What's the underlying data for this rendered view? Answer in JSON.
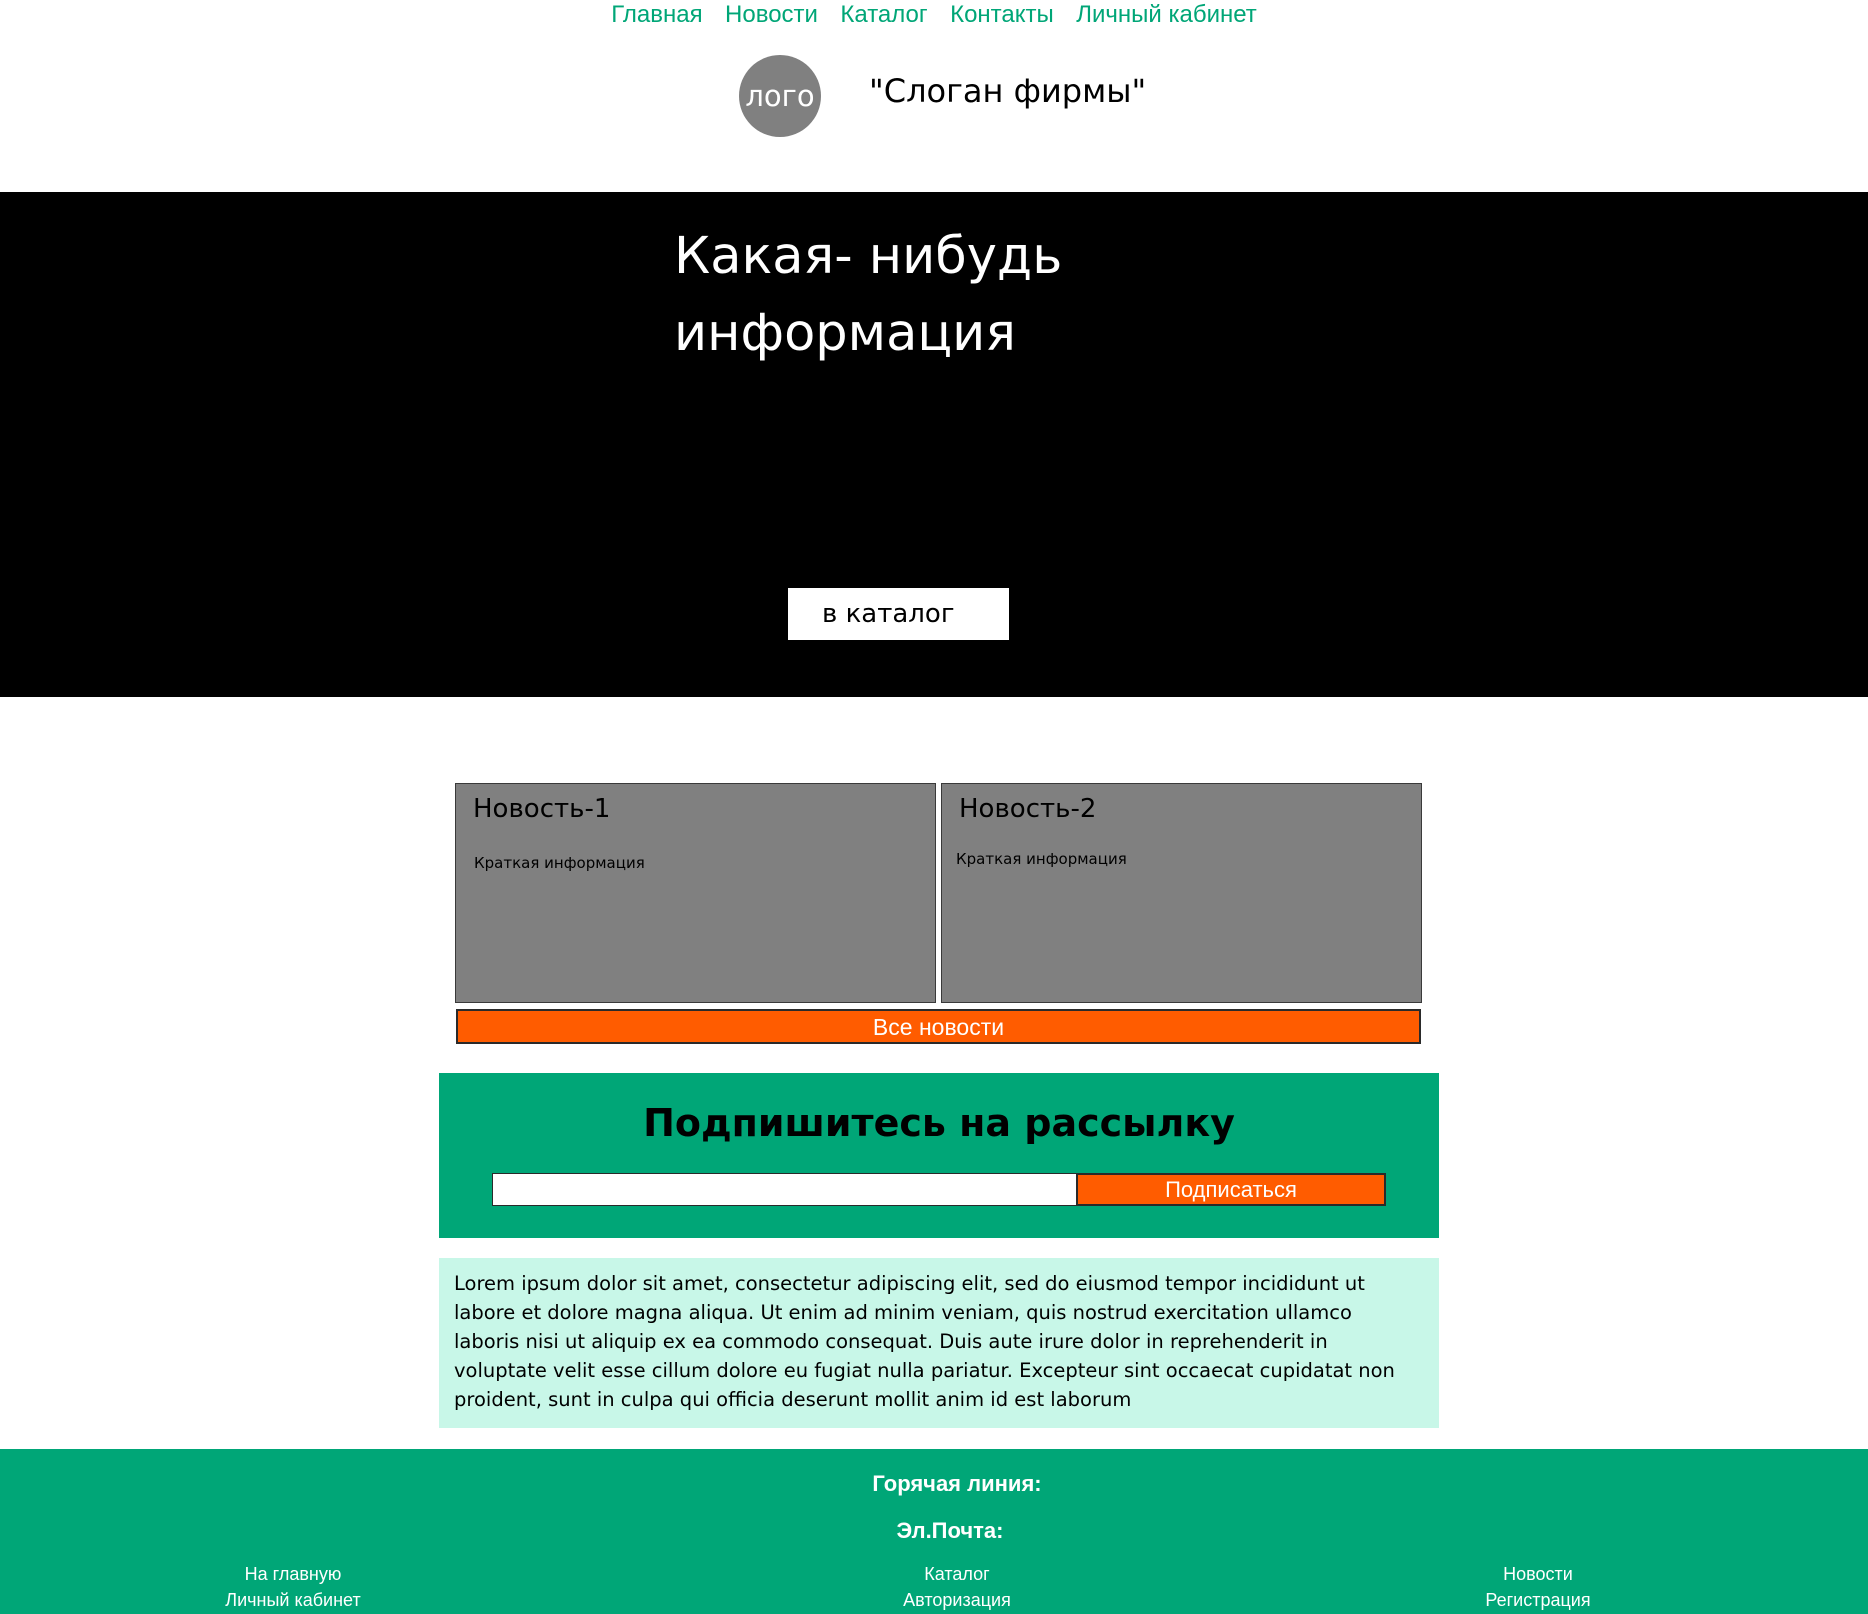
{
  "nav": {
    "items": [
      {
        "label": "Главная"
      },
      {
        "label": "Новости"
      },
      {
        "label": "Каталог"
      },
      {
        "label": "Контакты"
      },
      {
        "label": "Личный кабинет"
      }
    ]
  },
  "header": {
    "logo_text": "лого",
    "slogan": "\"Слоган фирмы\""
  },
  "hero": {
    "title": "Какая- нибудь информация",
    "button_label": "в каталог"
  },
  "news": {
    "cards": [
      {
        "title": "Новость-1",
        "text": "Краткая информация"
      },
      {
        "title": "Новость-2",
        "text": "Краткая информация"
      }
    ],
    "all_news_label": "Все новости"
  },
  "subscribe": {
    "title": "Подпишитесь на рассылку",
    "input_value": "",
    "button_label": "Подписаться"
  },
  "lorem": {
    "text": "Lorem ipsum dolor sit amet, consectetur adipiscing elit, sed do eiusmod tempor incididunt ut labore et dolore magna aliqua. Ut enim ad minim veniam, quis nostrud exercitation ullamco laboris nisi ut aliquip ex ea commodo consequat. Duis aute irure dolor in reprehenderit in voluptate velit esse cillum dolore eu fugiat nulla pariatur. Excepteur sint occaecat cupidatat non proident, sunt in culpa qui officia deserunt mollit anim id est laborum"
  },
  "footer": {
    "hotline_label": "Горячая линия:",
    "email_label": "Эл.Почта:",
    "columns": [
      {
        "links": [
          {
            "label": "На главную"
          },
          {
            "label": "Личный кабинет"
          }
        ]
      },
      {
        "links": [
          {
            "label": "Каталог"
          },
          {
            "label": "Авторизация"
          }
        ]
      },
      {
        "links": [
          {
            "label": "Новости"
          },
          {
            "label": "Регистрация"
          }
        ]
      }
    ]
  },
  "colors": {
    "accent_green": "#00a677",
    "accent_orange": "#ff5c00",
    "light_mint": "#c8f7e8",
    "card_gray": "#808080"
  }
}
